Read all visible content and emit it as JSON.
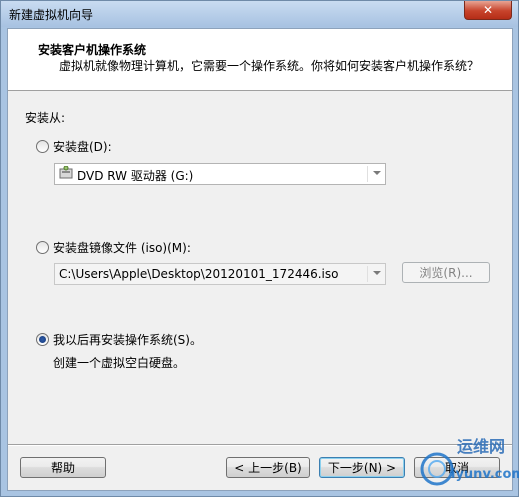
{
  "window": {
    "title": "新建虚拟机向导",
    "close_label": "✕"
  },
  "header": {
    "title": "安装客户机操作系统",
    "description": "虚拟机就像物理计算机，它需要一个操作系统。你将如何安装客户机操作系统？"
  },
  "install_from": {
    "label": "安装从:",
    "options": [
      {
        "label": "安装盘(D):",
        "selected": false
      },
      {
        "label": "安装盘镜像文件 (iso)(M):",
        "selected": false
      },
      {
        "label": "我以后再安装操作系统(S)。",
        "selected": true
      }
    ],
    "disc_drive": "DVD RW 驱动器 (G:)",
    "iso_path": "C:\\Users\\Apple\\Desktop\\20120101_172446.iso",
    "browse_label": "浏览(R)...",
    "later_note": "创建一个虚拟空白硬盘。"
  },
  "footer": {
    "help_label": "帮助",
    "back_label": "< 上一步(B)",
    "next_label": "下一步(N) >",
    "cancel_label": "取消"
  },
  "watermark": {
    "line1": "运维网",
    "line2": "iyunv.com"
  }
}
